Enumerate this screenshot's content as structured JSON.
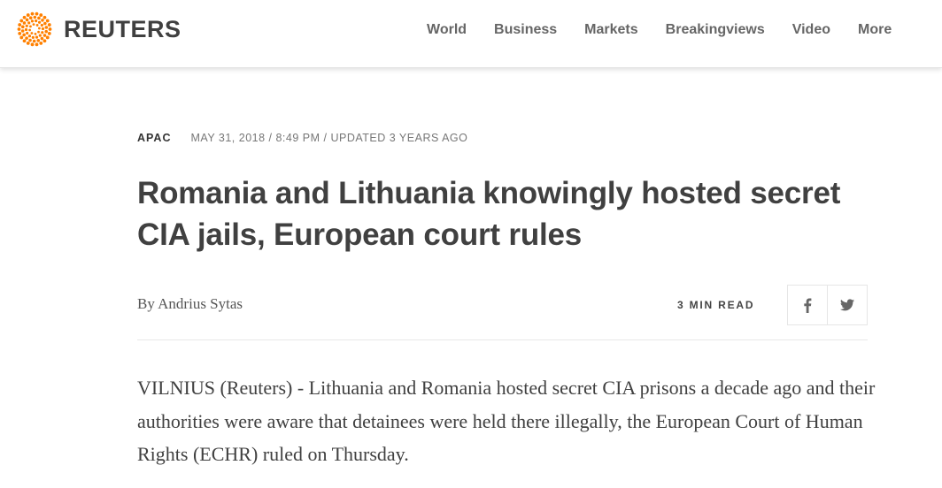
{
  "header": {
    "logo_text": "REUTERS",
    "brand_color": "#ff8000",
    "nav": [
      "World",
      "Business",
      "Markets",
      "Breakingviews",
      "Video",
      "More"
    ]
  },
  "article": {
    "section": "APAC",
    "dateline": "MAY 31, 2018 / 8:49 PM / UPDATED 3 YEARS AGO",
    "headline": "Romania and Lithuania knowingly hosted secret CIA jails, European court rules",
    "byline_prefix": "By",
    "author": "Andrius Sytas",
    "read_time": "3 MIN READ",
    "share": {
      "facebook_icon": "facebook-icon",
      "twitter_icon": "twitter-icon"
    },
    "body": "VILNIUS (Reuters) - Lithuania and Romania hosted secret CIA prisons a decade ago and their authorities were aware that detainees were held there illegally, the European Court of Human Rights (ECHR) ruled on Thursday."
  }
}
